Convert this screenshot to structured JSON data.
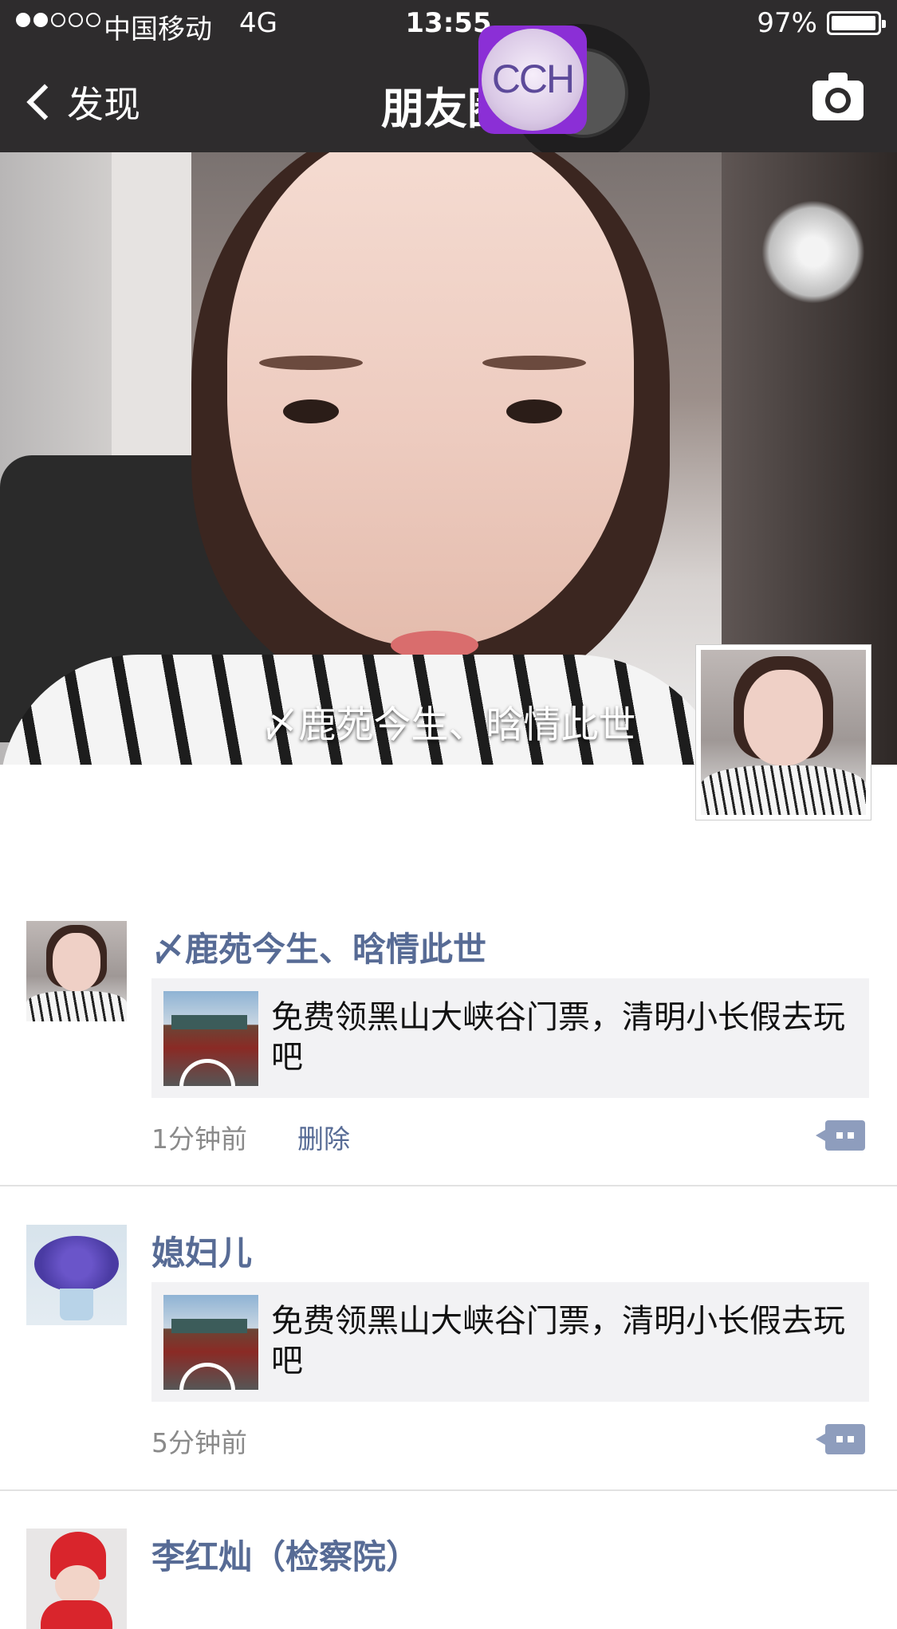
{
  "status_bar": {
    "carrier": "中国移动",
    "network": "4G",
    "time": "13:55",
    "battery_pct": "97%",
    "signal_bars_filled": 2,
    "signal_bars_total": 5
  },
  "nav": {
    "back_label": "发现",
    "title": "朋友圈"
  },
  "floating_app": {
    "label": "CCH"
  },
  "cover": {
    "name": "〆鹿苑今生、晗情此世"
  },
  "posts": [
    {
      "nickname": "〆鹿苑今生、晗情此世",
      "share_text": "免费领黑山大峡谷门票，清明小长假去玩吧",
      "time": "1分钟前",
      "delete_label": "删除"
    },
    {
      "nickname": "媳妇儿",
      "share_text": "免费领黑山大峡谷门票，清明小长假去玩吧",
      "time": "5分钟前"
    },
    {
      "nickname": "李红灿（检察院）"
    }
  ],
  "colors": {
    "nav_bg": "#2e2c2d",
    "link": "#576b95",
    "card_bg": "#f2f2f4",
    "comment_button": "#8e9dbd"
  },
  "icons": {
    "back": "chevron-left-icon",
    "camera": "camera-icon",
    "comment": "comment-icon"
  }
}
